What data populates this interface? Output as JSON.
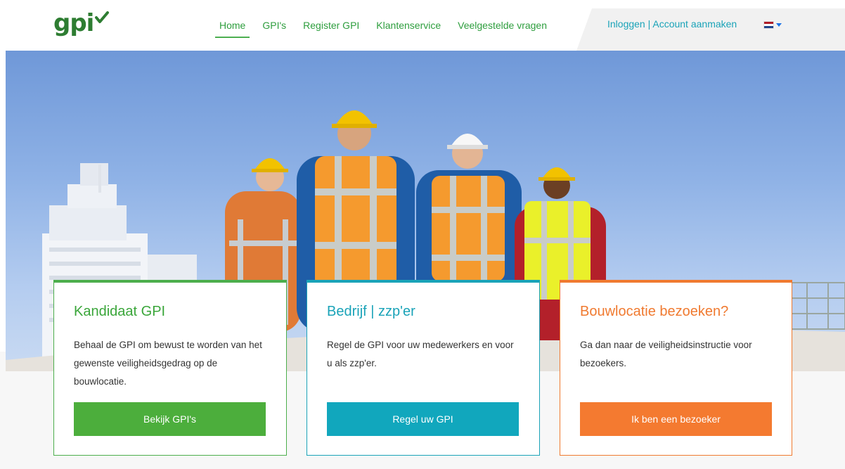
{
  "brand": {
    "logo_text": "gpi"
  },
  "nav": {
    "items": [
      {
        "label": "Home",
        "active": true
      },
      {
        "label": "GPI's",
        "active": false
      },
      {
        "label": "Register GPI",
        "active": false
      },
      {
        "label": "Klantenservice",
        "active": false
      },
      {
        "label": "Veelgestelde vragen",
        "active": false
      }
    ],
    "account_link": "Inloggen | Account aanmaken",
    "language": {
      "icon": "netherlands-flag-icon",
      "caret_icon": "chevron-down-icon"
    }
  },
  "cards": [
    {
      "title": "Kandidaat GPI",
      "text": "Behaal de GPI om bewust te worden van het gewenste veiligheidsgedrag op de bouwlocatie.",
      "button": "Bekijk GPI's",
      "color": "#4cae3c"
    },
    {
      "title": "Bedrijf | zzp'er",
      "text": "Regel de GPI voor uw medewerkers en voor u als zzp'er.",
      "button": "Regel uw GPI",
      "color": "#11a7bd"
    },
    {
      "title": "Bouwlocatie bezoeken?",
      "text": "Ga dan naar de veiligheidsinstructie voor bezoekers.",
      "button": "Ik ben een bezoeker",
      "color": "#f47a30"
    }
  ],
  "colors": {
    "brand_green": "#2e7d32",
    "link_teal": "#1aa3b8",
    "accent_orange": "#f07a30"
  }
}
